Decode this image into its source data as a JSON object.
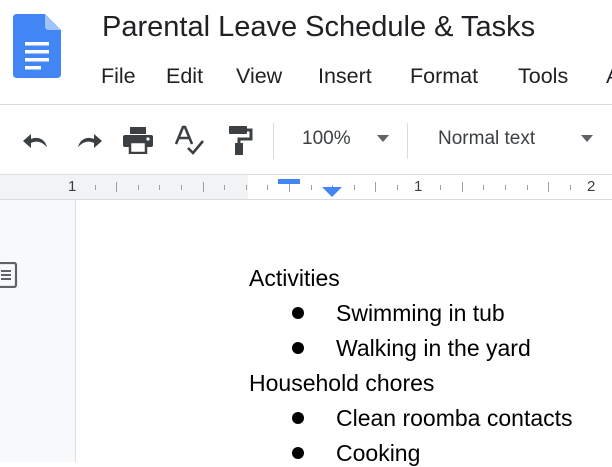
{
  "app": {
    "document_title": "Parental Leave Schedule & Tasks"
  },
  "menu": [
    "File",
    "Edit",
    "View",
    "Insert",
    "Format",
    "Tools",
    "A"
  ],
  "toolbar": {
    "buttons": [
      "undo-icon",
      "redo-icon",
      "print-icon",
      "spellcheck-icon",
      "paint-format-icon"
    ],
    "zoom": "100%",
    "style": "Normal text"
  },
  "ruler": {
    "labels": [
      "1",
      "1",
      "2"
    ]
  },
  "document": {
    "sections": [
      {
        "heading": "Activities",
        "items": [
          "Swimming in tub",
          "Walking in the yard"
        ]
      },
      {
        "heading": "Household chores",
        "items": [
          "Clean roomba contacts",
          "Cooking"
        ]
      }
    ]
  },
  "colors": {
    "brand_blue": "#4285f4",
    "text": "#202124",
    "divider": "#dadce0",
    "canvas": "#f8f9fa"
  }
}
